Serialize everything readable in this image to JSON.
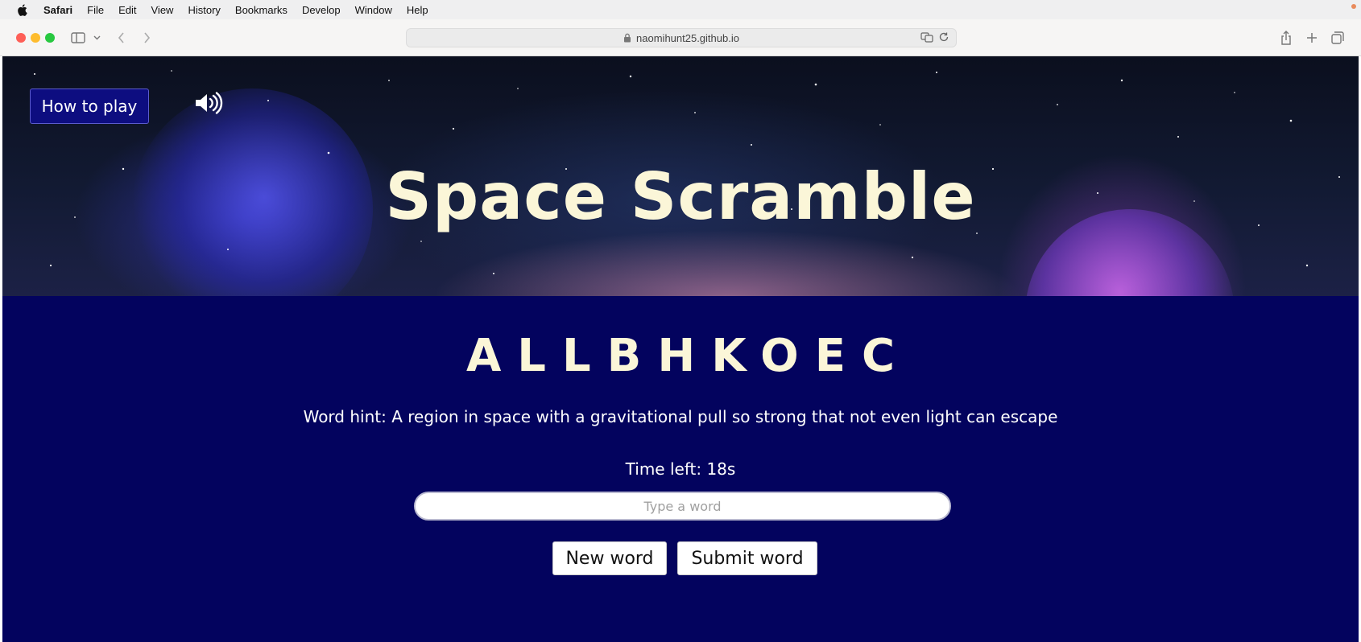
{
  "menubar": {
    "app": "Safari",
    "items": [
      "File",
      "Edit",
      "View",
      "History",
      "Bookmarks",
      "Develop",
      "Window",
      "Help"
    ]
  },
  "browser": {
    "url": "naomihunt25.github.io"
  },
  "game": {
    "how_to_play": "How to play",
    "sound_icon": "speaker-volume-icon",
    "title": "Space Scramble",
    "scrambled_word": "ALLBHKOEC",
    "hint": "Word hint: A region in space with a gravitational pull so strong that not even light can escape",
    "timer": "Time left: 18s",
    "input_placeholder": "Type a word",
    "input_value": "",
    "new_word_label": "New word",
    "submit_label": "Submit word"
  },
  "colors": {
    "main_bg": "#03035e",
    "title_text": "#fbf6d8",
    "how_to_bg": "#0d0d80"
  }
}
